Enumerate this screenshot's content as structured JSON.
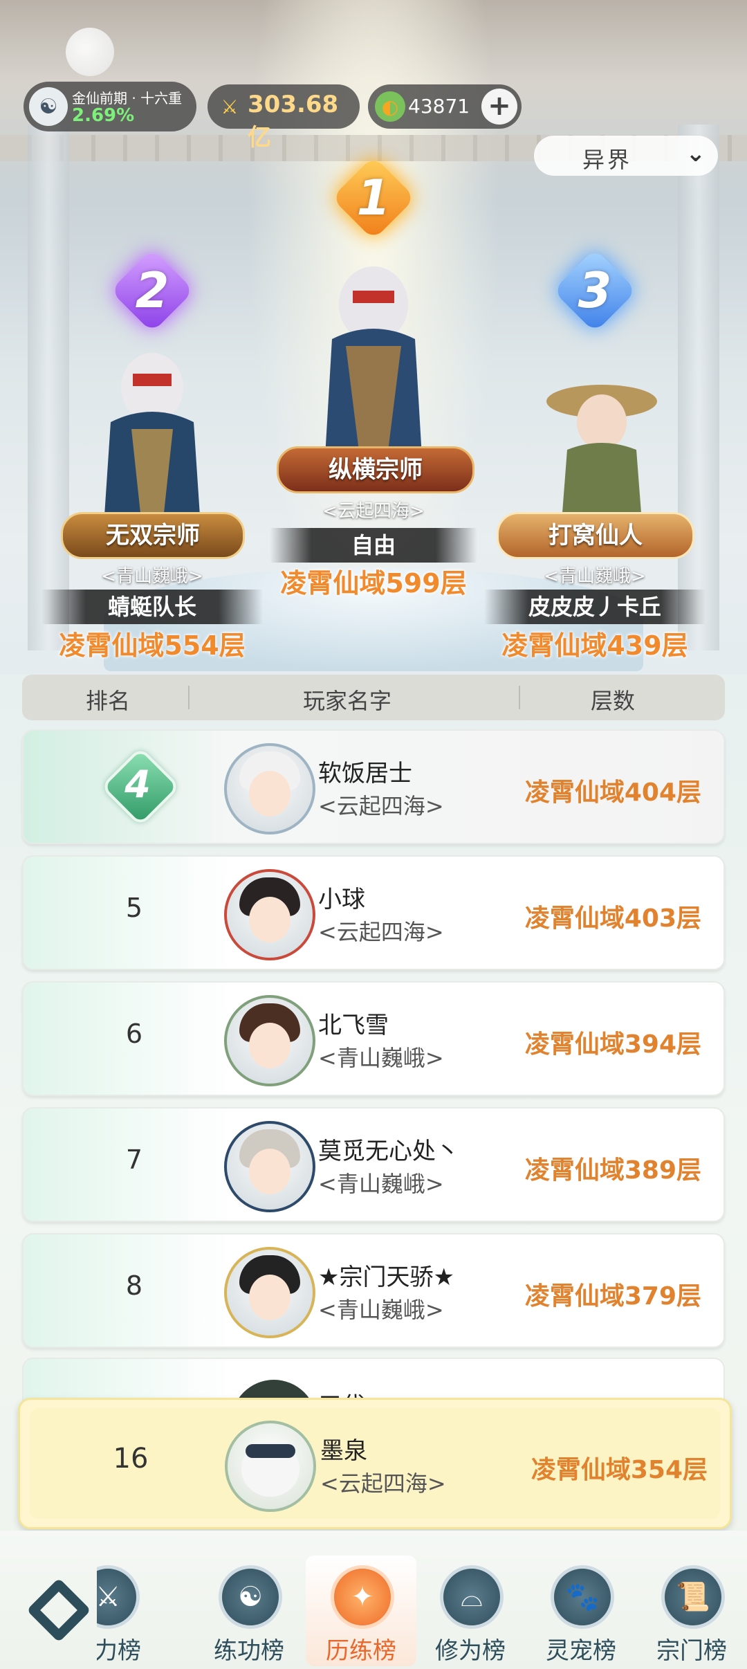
{
  "status": {
    "realm_name": "金仙前期 · 十六重",
    "realm_percent": "2.69%",
    "power_value": "303.68亿",
    "jade_value": "43871",
    "plus_icon": "plus-icon"
  },
  "filter": {
    "selected": "异界"
  },
  "podium": [
    {
      "rank": "1",
      "title": "纵横宗师",
      "guild": "<云起四海>",
      "name": "自由",
      "floor": "凌霄仙域599层"
    },
    {
      "rank": "2",
      "title": "无双宗师",
      "guild": "<青山巍峨>",
      "name": "蜻蜓队长",
      "floor": "凌霄仙域554层"
    },
    {
      "rank": "3",
      "title": "打窝仙人",
      "guild": "<青山巍峨>",
      "name": "皮皮皮丿卡丘",
      "floor": "凌霄仙域439层"
    }
  ],
  "table": {
    "headers": {
      "rank": "排名",
      "name": "玩家名字",
      "floor": "层数"
    },
    "rows": [
      {
        "rank": "4",
        "name": "软饭居士",
        "guild": "<云起四海>",
        "floor": "凌霄仙域404层"
      },
      {
        "rank": "5",
        "name": "小球",
        "guild": "<云起四海>",
        "floor": "凌霄仙域403层"
      },
      {
        "rank": "6",
        "name": "北飞雪",
        "guild": "<青山巍峨>",
        "floor": "凌霄仙域394层"
      },
      {
        "rank": "7",
        "name": "莫觅无心处丶",
        "guild": "<青山巍峨>",
        "floor": "凌霄仙域389层"
      },
      {
        "rank": "8",
        "name": "★宗门天骄★",
        "guild": "<青山巍峨>",
        "floor": "凌霄仙域379层"
      }
    ],
    "partial_name": "三代"
  },
  "me": {
    "rank": "16",
    "name": "墨泉",
    "guild": "<云起四海>",
    "floor": "凌霄仙域354层"
  },
  "nav": {
    "tabs": [
      {
        "label": "力榜",
        "icon": "sword-icon"
      },
      {
        "label": "练功榜",
        "icon": "yin-yang-icon"
      },
      {
        "label": "历练榜",
        "icon": "star-compass-icon"
      },
      {
        "label": "修为榜",
        "icon": "hat-icon"
      },
      {
        "label": "灵宠榜",
        "icon": "cat-icon"
      },
      {
        "label": "宗门榜",
        "icon": "scroll-icon"
      }
    ],
    "active_tab": "历练榜"
  }
}
